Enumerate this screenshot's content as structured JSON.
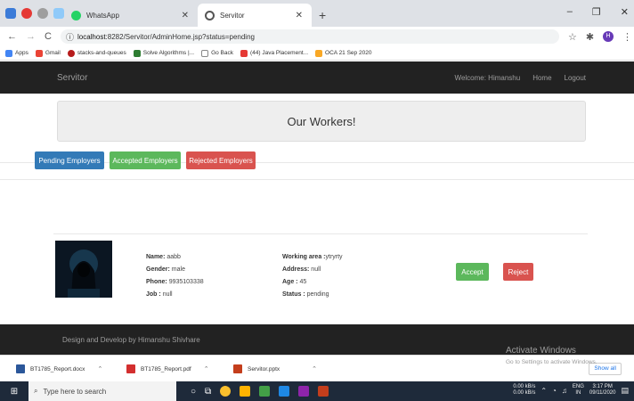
{
  "browser": {
    "tabs": [
      {
        "label": "WhatsApp",
        "active": false
      },
      {
        "label": "Servitor",
        "active": true
      }
    ],
    "url_host": "localhost",
    "url_rest": ":8282/Servitor/AdminHome.jsp?status=pending",
    "profile_initial": "H",
    "bookmarks": [
      "Apps",
      "Gmail",
      "stacks-and-queues",
      "Solve Algorithms |...",
      "Go Back",
      "(44) Java Placement...",
      "OCA 21 Sep 2020"
    ]
  },
  "navbar": {
    "brand": "Servitor",
    "welcome": "Welcome: Himanshu",
    "home": "Home",
    "logout": "Logout"
  },
  "jumbotron": {
    "title": "Our Workers!"
  },
  "filters": {
    "pending": "Pending Employers",
    "accepted": "Accepted Employers",
    "rejected": "Rejected Employers"
  },
  "worker": {
    "name_label": "Name:",
    "name": "aabb",
    "gender_label": "Gender:",
    "gender": "male",
    "phone_label": "Phone:",
    "phone": "9935103338",
    "job_label": "Job :",
    "job": "null",
    "area_label": "Working area :",
    "area": "ytryrty",
    "address_label": "Address:",
    "address": "null",
    "age_label": "Age :",
    "age": "45",
    "status_label": "Status :",
    "status": "pending",
    "accept": "Accept",
    "reject": "Reject"
  },
  "footer": {
    "text": "Design and Develop by Himanshu Shivhare"
  },
  "watermark": {
    "title": "Activate Windows",
    "subtitle": "Go to Settings to activate Windows."
  },
  "downloads": {
    "files": [
      "BT1785_Report.docx",
      "BT1785_Report.pdf",
      "Servitor.pptx"
    ],
    "show_all": "Show all"
  },
  "taskbar": {
    "search_placeholder": "Type here to search",
    "net_up": "0.00 kB/s",
    "net_down": "0.00 kB/s",
    "lang": "ENG",
    "region": "IN",
    "time": "3:17 PM",
    "date": "09/11/2020"
  },
  "colors": {
    "primary": "#337ab7",
    "success": "#5cb85c",
    "danger": "#d9534f",
    "navbar": "#222222"
  }
}
